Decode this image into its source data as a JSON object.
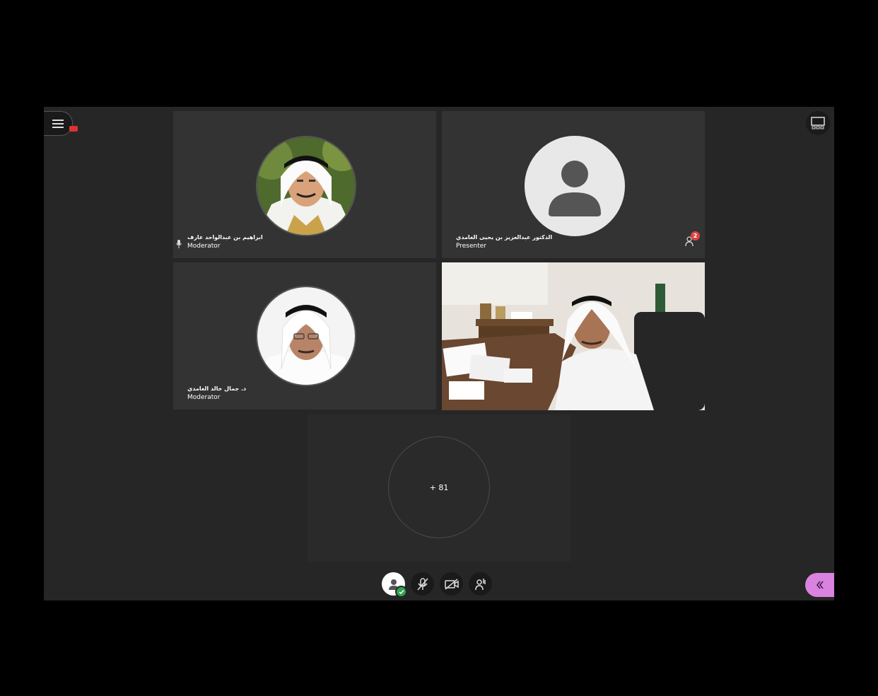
{
  "icons": {
    "menu": "hamburger-menu-icon",
    "recording": "recording-icon",
    "layout": "grid-layout-icon",
    "mic": "microphone-icon",
    "hand": "raise-hand-icon",
    "avatar": "user-avatar-icon",
    "mic_off": "microphone-muted-icon",
    "camera_off": "camera-off-icon",
    "panel": "chevron-left-double-icon"
  },
  "colors": {
    "background": "#262626",
    "tile": "#333333",
    "accent_panel": "#d982e0",
    "status_green": "#2ea44f",
    "badge_red": "#d44444"
  },
  "participants": [
    {
      "name": "ابراهيم بن عبدالواحد عارف",
      "role": "Moderator",
      "speaking": true
    },
    {
      "name": "الدكتور عبدالعزيز بن يحيى الغامدي",
      "role": "Presenter",
      "raised_hands": "2"
    },
    {
      "name": "د. جمال خالد الغامدي",
      "role": "Moderator"
    },
    {
      "name": "",
      "role": "",
      "video": true
    }
  ],
  "overflow": {
    "label": "+ 81"
  }
}
